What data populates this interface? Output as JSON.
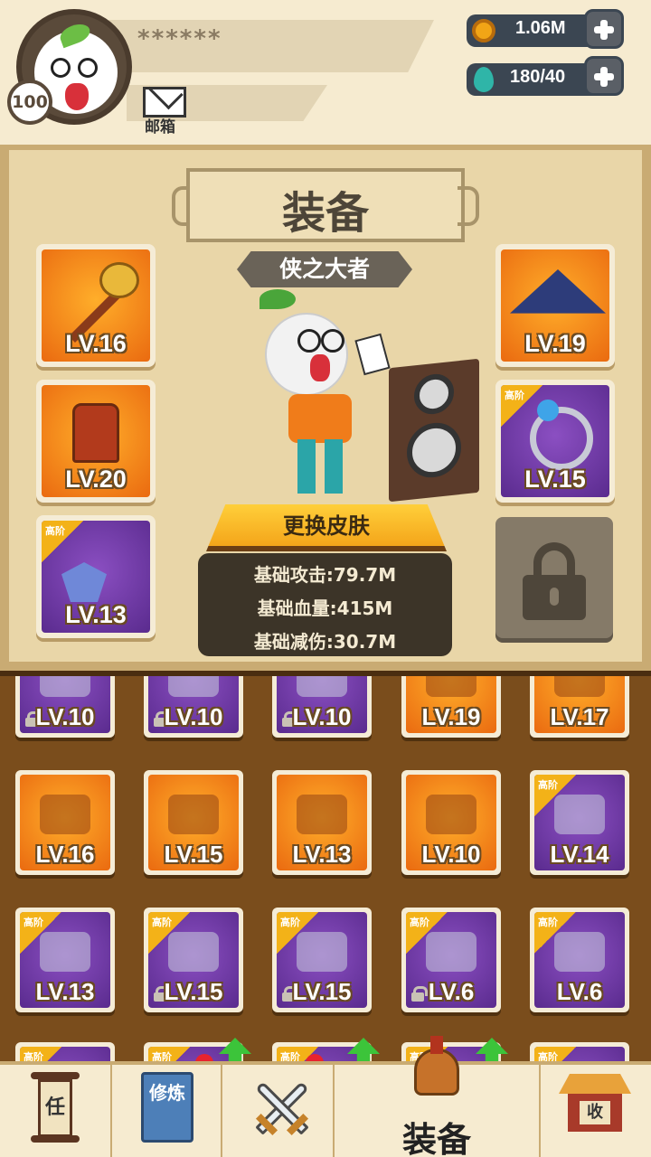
{
  "player": {
    "name": "******",
    "level": "100",
    "mail_label": "邮箱"
  },
  "resources": {
    "coins": "1.06M",
    "stamina": "180/40"
  },
  "panel": {
    "title": "装备",
    "hero_title": "侠之大者",
    "change_skin_label": "更换皮肤",
    "stats": [
      "基础攻击:79.7M",
      "基础血量:415M",
      "基础减伤:30.7M"
    ]
  },
  "tier_label": "高阶",
  "equipped": [
    {
      "level": "LV.16",
      "color": "orange",
      "item": "club-icon"
    },
    {
      "level": "LV.20",
      "color": "orange",
      "item": "armor-icon"
    },
    {
      "level": "LV.13",
      "color": "purple",
      "item": "necklace-icon",
      "tier": true
    },
    {
      "level": "LV.19",
      "color": "orange",
      "item": "hat-icon"
    },
    {
      "level": "LV.15",
      "color": "purple",
      "item": "ring-icon",
      "tier": true
    }
  ],
  "inventory": [
    {
      "level": "LV.10",
      "color": "purple",
      "locked": true,
      "item": "item-icon"
    },
    {
      "level": "LV.10",
      "color": "purple",
      "locked": true,
      "item": "item-icon"
    },
    {
      "level": "LV.10",
      "color": "purple",
      "locked": true,
      "item": "item-icon"
    },
    {
      "level": "LV.19",
      "color": "orange",
      "locked": false,
      "item": "sword-icon"
    },
    {
      "level": "LV.17",
      "color": "orange",
      "locked": false,
      "item": "wand-icon"
    },
    {
      "level": "LV.16",
      "color": "orange",
      "locked": false,
      "item": "staff-icon"
    },
    {
      "level": "LV.15",
      "color": "orange",
      "locked": false,
      "item": "spear-icon"
    },
    {
      "level": "LV.13",
      "color": "orange",
      "locked": false,
      "item": "bow-icon"
    },
    {
      "level": "LV.10",
      "color": "orange",
      "locked": false,
      "item": "robe-icon"
    },
    {
      "level": "LV.14",
      "color": "purple",
      "locked": false,
      "item": "gauntlet-icon",
      "tier": true
    },
    {
      "level": "LV.13",
      "color": "purple",
      "locked": false,
      "item": "blade-icon",
      "tier": true
    },
    {
      "level": "LV.15",
      "color": "purple",
      "locked": true,
      "item": "ring-icon",
      "tier": true
    },
    {
      "level": "LV.15",
      "color": "purple",
      "locked": true,
      "item": "ring-icon",
      "tier": true
    },
    {
      "level": "LV.6",
      "color": "purple",
      "locked": true,
      "item": "bracer-icon",
      "tier": true
    },
    {
      "level": "LV.6",
      "color": "purple",
      "locked": false,
      "item": "bracer-icon",
      "tier": true
    }
  ],
  "nav": {
    "quest_char": "任",
    "cultivate_chars": "修炼",
    "equip_label": "装备",
    "shop_char": "收"
  },
  "colors": {
    "orange_top": "#ffae2a",
    "purple_top": "#8b4fc2",
    "panel_bg": "#e9d6a8",
    "inventory_bg": "#7a4d1c"
  }
}
